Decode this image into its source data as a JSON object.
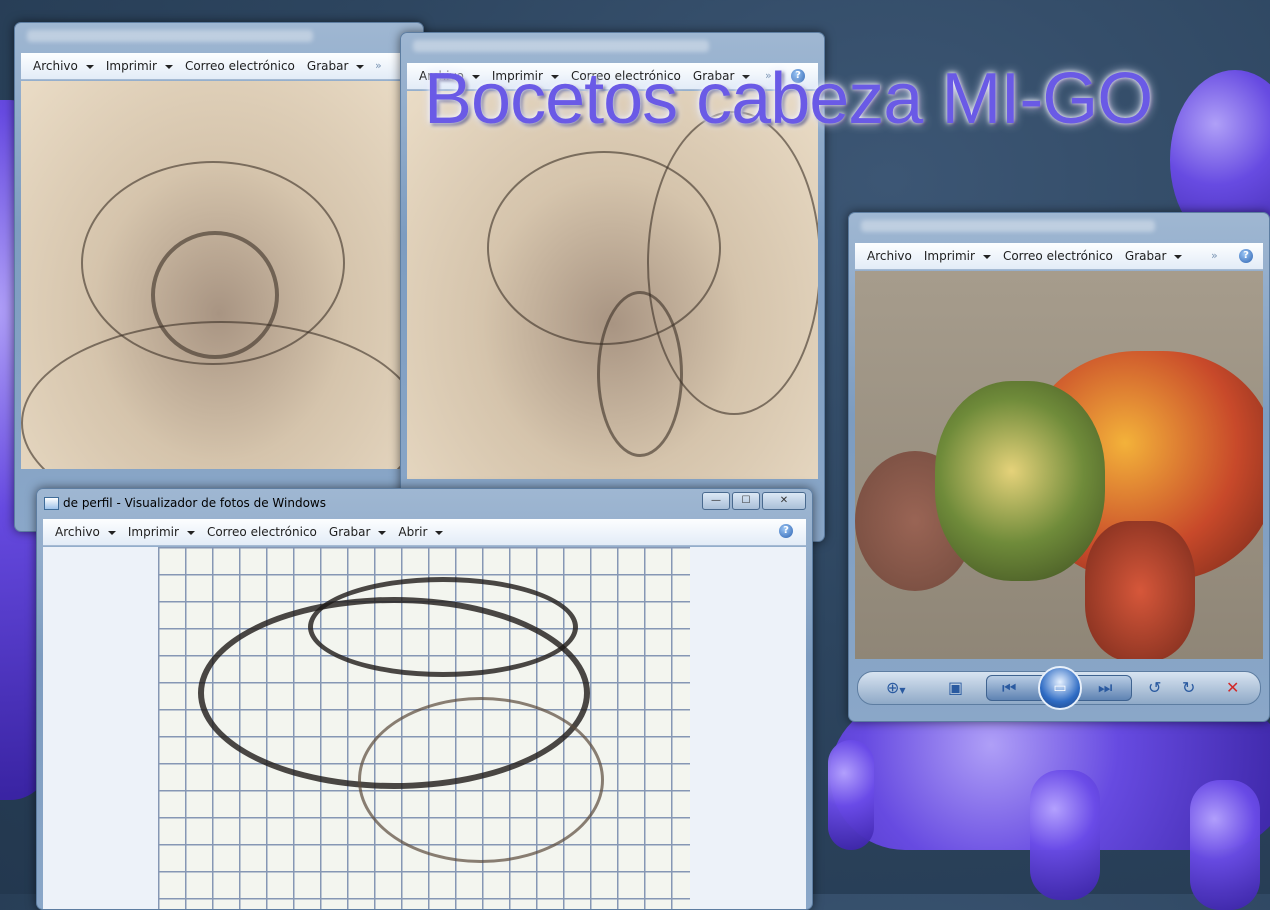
{
  "desktop": {
    "title_overlay": "Bocetos cabeza MI-GO"
  },
  "menus": {
    "archivo": "Archivo",
    "imprimir": "Imprimir",
    "correo": "Correo electrónico",
    "grabar": "Grabar",
    "abrir": "Abrir"
  },
  "window_front": {
    "title": "de perfil - Visualizador de fotos de Windows"
  },
  "window_buttons": {
    "minimize": "—",
    "maximize": "☐",
    "close": "✕"
  },
  "viewer_toolbar": {
    "zoom": "zoom-icon",
    "fit": "fit-to-window-icon",
    "previous": "previous-icon",
    "slideshow": "slideshow-icon",
    "next": "next-icon",
    "rotate_left": "rotate-left-icon",
    "rotate_right": "rotate-right-icon",
    "delete": "delete-icon"
  },
  "colors": {
    "title_overlay": "#6a5ae6",
    "creature": "#6a4be8",
    "delete": "#d22a2a"
  }
}
